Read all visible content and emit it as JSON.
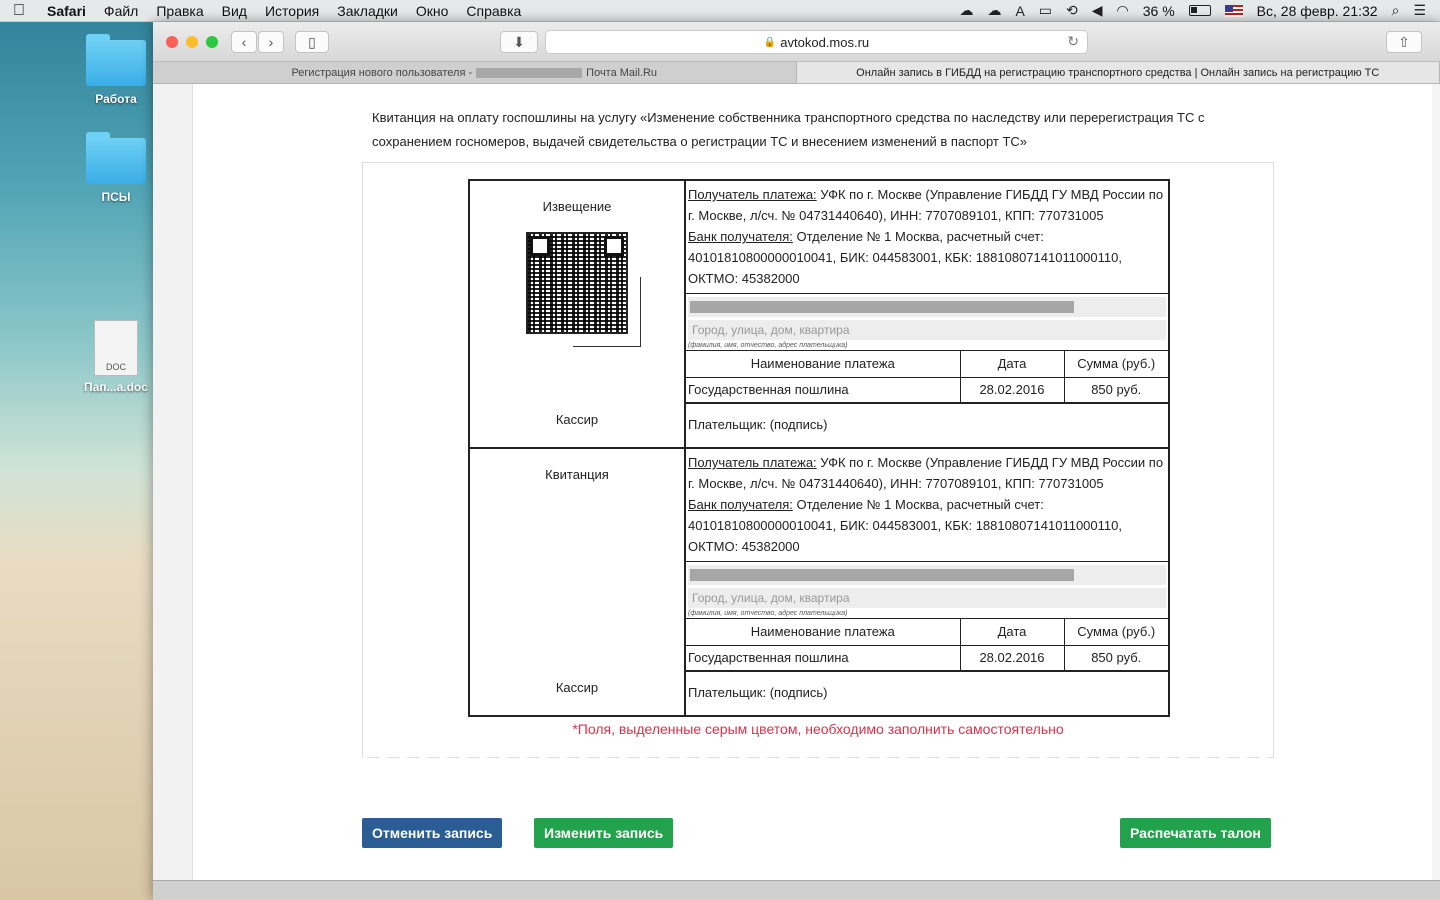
{
  "menubar": {
    "app": "Safari",
    "items": [
      "Файл",
      "Правка",
      "Вид",
      "История",
      "Закладки",
      "Окно",
      "Справка"
    ],
    "battery": "36 %",
    "datetime": "Вс, 28 февр.  21:32"
  },
  "desktop": {
    "icons": [
      {
        "label": "Работа"
      },
      {
        "label": "ПСЫ"
      },
      {
        "label": "Пап...a.doc",
        "badge": "DOC"
      }
    ]
  },
  "browser": {
    "url": "avtokod.mos.ru",
    "tabs": [
      {
        "left": "Регистрация нового пользователя -",
        "right": "Почта Mail.Ru"
      },
      {
        "label": "Онлайн запись в ГИБДД на регистрацию транспортного средства | Онлайн запись на регистрацию ТС"
      }
    ]
  },
  "page": {
    "intro": "Квитанция на оплату госпошлины на услугу «Изменение собственника транспортного средства по наследству или перерегистрация ТС с сохранением госномеров, выдачей свидетельства о регистрации ТС и внесением изменений в паспорт ТС»",
    "sections": [
      {
        "title": "Извещение",
        "cashier": "Кассир",
        "recipient_label": "Получатель платежа:",
        "recipient": " УФК по г. Москве (Управление ГИБДД ГУ МВД России по г. Москве, л/сч. № 04731440640), ИНН: 7707089101, КПП: 770731005",
        "bank_label": "Банк получателя:",
        "bank": " Отделение № 1 Москва, расчетный счет: 40101810800000010041, БИК: 044583001, КБК: 18810807141011000110, ОКТМО: 45382000",
        "address_placeholder": "Город, улица, дом, квартира",
        "hint": "(фамилия, имя, отчество, адрес плательщика)",
        "col_name": "Наименование платежа",
        "col_date": "Дата",
        "col_sum": "Сумма (руб.)",
        "pay_name": "Государственная пошлина",
        "pay_date": "28.02.2016",
        "pay_sum": "850 руб.",
        "payer": "Плательщик: (подпись)"
      },
      {
        "title": "Квитанция",
        "cashier": "Кассир",
        "recipient_label": "Получатель платежа:",
        "recipient": " УФК по г. Москве (Управление ГИБДД ГУ МВД России по г. Москве, л/сч. № 04731440640), ИНН: 7707089101, КПП: 770731005",
        "bank_label": "Банк получателя:",
        "bank": " Отделение № 1 Москва, расчетный счет: 40101810800000010041, БИК: 044583001, КБК: 18810807141011000110, ОКТМО: 45382000",
        "address_placeholder": "Город, улица, дом, квартира",
        "hint": "(фамилия, имя, отчество, адрес плательщика)",
        "col_name": "Наименование платежа",
        "col_date": "Дата",
        "col_sum": "Сумма (руб.)",
        "pay_name": "Государственная пошлина",
        "pay_date": "28.02.2016",
        "pay_sum": "850 руб.",
        "payer": "Плательщик: (подпись)"
      }
    ],
    "note": "*Поля, выделенные серым цветом, необходимо заполнить самостоятельно",
    "buttons": {
      "cancel": "Отменить запись",
      "change": "Изменить запись",
      "print": "Распечатать талон"
    }
  },
  "colors": {
    "cancel_button": "#2a5d94",
    "change_button": "#23a24d",
    "print_button": "#23a24d",
    "note": "#d9334b"
  }
}
